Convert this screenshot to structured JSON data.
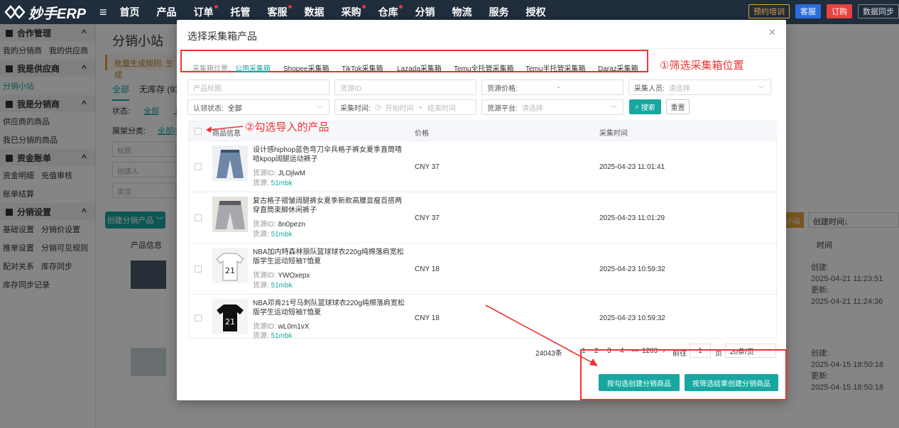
{
  "header": {
    "logo_text": "妙手ERP",
    "menu_icon": "hamburger-icon",
    "nav": [
      "首页",
      "产品",
      "订单",
      "托管",
      "客服",
      "数据",
      "采购",
      "仓库",
      "分销",
      "物流",
      "服务",
      "授权"
    ],
    "actions": [
      "预约培训",
      "客服",
      "订购",
      "数据同步"
    ],
    "colors": {
      "bar": "#1f2d3d",
      "accent": "#18a6a0"
    }
  },
  "sidebar": {
    "groups": [
      {
        "label": "合作管理",
        "rows": [
          [
            "我的分销商",
            "我的供应商"
          ]
        ]
      },
      {
        "label": "我是供应商",
        "rows": [
          [
            "分销小站"
          ]
        ]
      },
      {
        "label": "我是分销商",
        "rows": [
          [
            "供应商的商品"
          ],
          [
            "我已分销的商品"
          ]
        ]
      },
      {
        "label": "资金账单",
        "rows": [
          [
            "资金明细",
            "充值审核"
          ],
          [
            "账单结算"
          ]
        ]
      },
      {
        "label": "分销设置",
        "rows": [
          [
            "基础设置",
            "分销价设置"
          ],
          [
            "推单设置",
            "分销可见规则"
          ],
          [
            "配对关系",
            "库存同步"
          ],
          [
            "库存同步记录"
          ]
        ]
      }
    ]
  },
  "background": {
    "title": "分销小站",
    "notice": "批量生成规则: 生成",
    "tabs": [
      "全部",
      "无库存 (932"
    ],
    "status_label": "状态:",
    "status_all": "全部",
    "status_up": "上",
    "cat_label": "展架分类:",
    "cat_all": "全部(2",
    "inputs": [
      "标题",
      "创建人",
      "类目"
    ],
    "create_button": "创建分销产品",
    "product_info_col": "产品信息",
    "time_col": "时间",
    "orange_btn": "小站",
    "sort": "创建时间↓",
    "times": [
      {
        "c_label": "创建:",
        "c": "2025-04-21 11:23:51",
        "u_label": "更新:",
        "u": "2025-04-21 11:24:36"
      },
      {
        "c_label": "创建:",
        "c": "2025-04-15 18:50:18",
        "u_label": "更新:",
        "u": "2025-04-15 18:50:18"
      }
    ]
  },
  "modal": {
    "title": "选择采集箱产品",
    "close_icon": "close-icon",
    "collection_label": "采集箱位置:",
    "collection_tabs": [
      "公用采集箱",
      "Shopee采集箱",
      "TikTok采集箱",
      "Lazada采集箱",
      "Temu全托管采集箱",
      "Temu半托管采集箱",
      "Daraz采集箱"
    ],
    "annotation1": "①筛选采集箱位置",
    "annotation2": "②勾选导入的产品",
    "filters": {
      "title_placeholder": "产品标题",
      "source_id_placeholder": "货源ID",
      "price_label": "货源价格:",
      "price_sep": "-",
      "collector_label": "采集人员:",
      "collector_placeholder": "请选择",
      "claim_label": "认领状态:",
      "claim_value": "全部",
      "time_label": "采集时间:",
      "time_start": "开始时间",
      "time_sep": "-",
      "time_end": "结束时间",
      "platform_label": "货源平台:",
      "platform_placeholder": "请选择",
      "search": "搜索",
      "reset": "重置"
    },
    "columns": [
      "商品信息",
      "价格",
      "采集时间"
    ],
    "rows": [
      {
        "name": "设计感hiphop蓝色弯刀伞兵格子裤女夏季直筒嘻哈kpop阔腿运动裤子",
        "id_label": "货源ID:",
        "id": "JLOjlwM",
        "src_label": "货源:",
        "src": "51mbk",
        "price": "CNY 37",
        "time": "2025-04-23 11:01:41"
      },
      {
        "name": "复古格子褶皱阔腿裤女夏季新款高腰显瘦百搭两穿直筒束脚休闲裤子",
        "id_label": "货源ID:",
        "id": "8n0pezn",
        "src_label": "货源:",
        "src": "51mbk",
        "price": "CNY 37",
        "time": "2025-04-23 11:01:29"
      },
      {
        "name": "NBA加内特森林狼队篮球球衣220g纯棉落肩宽松版学生运动短袖T恤夏",
        "id_label": "货源ID:",
        "id": "YWOxepx",
        "src_label": "货源:",
        "src": "51mbk",
        "price": "CNY 18",
        "time": "2025-04-23 10:59:32"
      },
      {
        "name": "NBA邓肯21号马刺队篮球球衣220g纯棉落肩宽松版学生运动短袖T恤夏",
        "id_label": "货源ID:",
        "id": "wL0m1vX",
        "src_label": "货源:",
        "src": "51mbk",
        "price": "CNY 18",
        "time": "2025-04-23 10:59:32"
      }
    ],
    "pagination": {
      "total": "24043条",
      "pages": [
        "1",
        "2",
        "3",
        "4",
        "•••",
        "1203"
      ],
      "goto_label": "前往",
      "goto_value": "1",
      "page_unit": "页",
      "page_size": "20条/页"
    },
    "btn_selected": "按勾选创建分销商品",
    "btn_filtered": "按筛选结果创建分销商品"
  }
}
